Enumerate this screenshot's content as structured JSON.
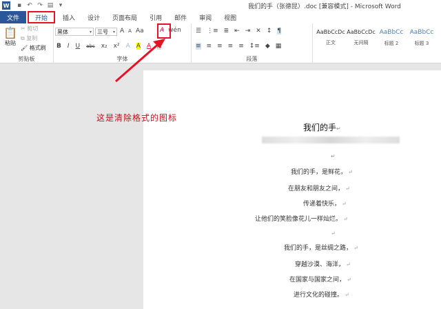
{
  "window": {
    "title": "我们的手（张德昆）.doc [兼容模式] - Microsoft Word",
    "app_icon_letter": "W"
  },
  "quick_access": [
    "save-icon",
    "undo-icon",
    "redo-icon",
    "print-preview-icon",
    "more-icon"
  ],
  "tabs": {
    "file": "文件",
    "items": [
      "开始",
      "插入",
      "设计",
      "页面布局",
      "引用",
      "邮件",
      "审阅",
      "视图"
    ]
  },
  "ribbon": {
    "clipboard": {
      "label": "剪贴板",
      "paste": "粘贴",
      "cut": "剪切",
      "copy": "复制",
      "format_painter": "格式刷"
    },
    "font": {
      "label": "字体",
      "font_name": "黑体",
      "font_size": "三号",
      "grow": "A",
      "shrink": "A",
      "change_case": "Aa",
      "bold": "B",
      "italic": "I",
      "underline": "U",
      "strike": "abc",
      "subscript": "x₂",
      "superscript": "x²",
      "font_color": "A",
      "highlight": "A",
      "clear_formatting": "A"
    },
    "paragraph": {
      "label": "段落"
    },
    "styles": {
      "items": [
        {
          "preview": "AaBbCcDc",
          "name": "正文"
        },
        {
          "preview": "AaBbCcDc",
          "name": "无间隔"
        },
        {
          "preview": "AaBbCc",
          "name": "标题 2"
        },
        {
          "preview": "AaBbCc",
          "name": "标题 3"
        }
      ]
    },
    "highlight_color": "#e81123",
    "accent": "#2b579a"
  },
  "annotation": "这是清除格式的图标",
  "document": {
    "heading": "我们的手",
    "lines": [
      "我们的手，是鲜花，",
      "在朋友和朋友之间，",
      "传递着快乐，",
      "让他们的笑脸像花儿一样灿烂。",
      "",
      "我们的手，是丝绸之路，",
      "穿越沙漠、海洋，",
      "在国家与国家之间，",
      "进行文化的碰撞。"
    ],
    "para_mark": "↵"
  }
}
